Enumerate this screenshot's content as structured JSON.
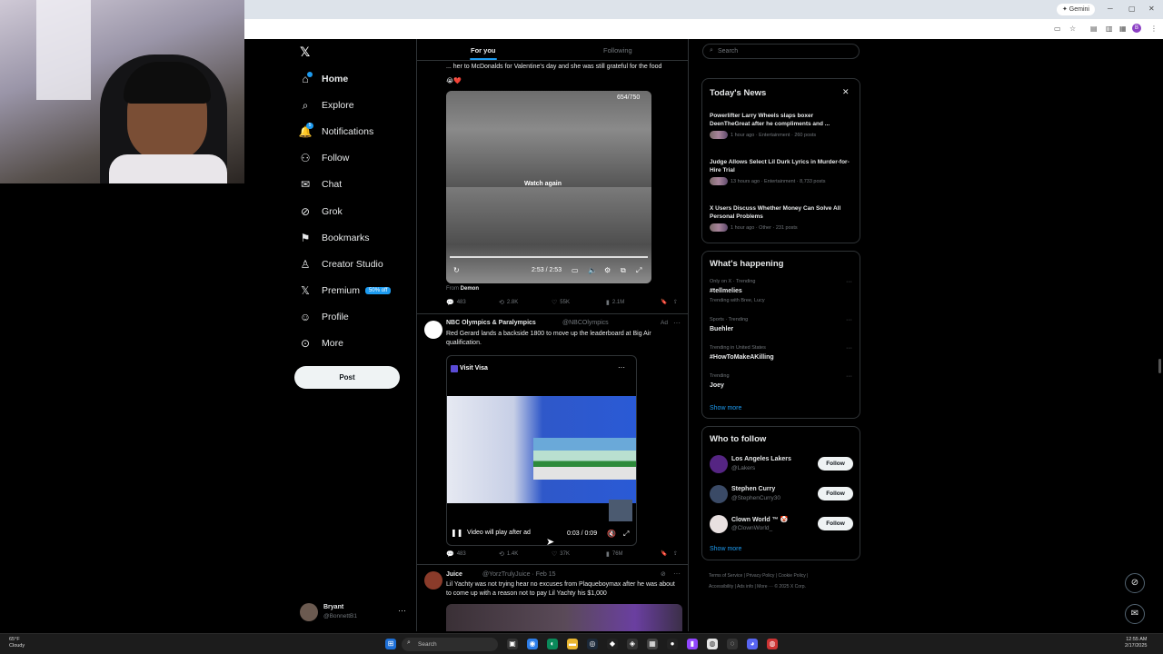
{
  "browser": {
    "gemini_label": "✦ Gemini",
    "profile_initial": "B"
  },
  "nav": {
    "items": [
      {
        "label": "Home",
        "icon": "home-icon"
      },
      {
        "label": "Explore",
        "icon": "search-icon"
      },
      {
        "label": "Notifications",
        "icon": "bell-icon",
        "badge": "5"
      },
      {
        "label": "Follow",
        "icon": "person-plus-icon"
      },
      {
        "label": "Chat",
        "icon": "chat-icon"
      },
      {
        "label": "Grok",
        "icon": "grok-icon"
      },
      {
        "label": "Bookmarks",
        "icon": "bookmark-icon"
      },
      {
        "label": "Creator Studio",
        "icon": "creator-icon"
      },
      {
        "label": "Premium",
        "icon": "x-icon"
      },
      {
        "label": "Profile",
        "icon": "person-icon"
      },
      {
        "label": "More",
        "icon": "more-circle-icon"
      }
    ],
    "premium_badge": "50% off",
    "post_label": "Post",
    "account_name": "Bryant",
    "account_handle": "@BonnettB1",
    "account_more": "···"
  },
  "timeline": {
    "tab_for_you": "For you",
    "tab_following": "Following",
    "tweet1": {
      "text": "... her to McDonalds for Valentine's day and she was still grateful for the food",
      "video_counter": "654/750",
      "watch_again": "Watch again",
      "time": "2:53 / 2:53",
      "from_prefix": "From",
      "from_name": "Demon",
      "replies": "483",
      "reposts": "2.8K",
      "likes": "55K",
      "views": "2.1M"
    },
    "tweet2": {
      "name": "NBC Olympics & Paralympics",
      "handle": "@NBCOlympics",
      "ad_label": "Ad",
      "text": "Red Gerard lands a backside 1800 to move up the leaderboard at Big Air qualification.",
      "visit_label": "Visit Visa",
      "play_label": "Video will play after ad",
      "time": "0:03 / 0:09",
      "replies": "483",
      "reposts": "1.4K",
      "likes": "37K",
      "views": "76M"
    },
    "tweet3": {
      "name": "Juice",
      "handle": "@YorzTrulyJuice · Feb 15",
      "text": "Lil Yachty was not trying hear no excuses from Plaqueboymax after he was about to come up with a reason not to pay Lil Yachty his $1,000"
    }
  },
  "right": {
    "search_placeholder": "Search",
    "news_title": "Today's News",
    "news": [
      {
        "headline": "Powerlifter Larry Wheels slaps boxer DeenTheGreat after he compliments and ...",
        "meta": "1 hour ago · Entertainment · 260 posts"
      },
      {
        "headline": "Judge Allows Select Lil Durk Lyrics in Murder-for-Hire Trial",
        "meta": "13 hours ago · Entertainment · 8,733 posts"
      },
      {
        "headline": "X Users Discuss Whether Money Can Solve All Personal Problems",
        "meta": "1 hour ago · Other · 231 posts"
      }
    ],
    "happening_title": "What's happening",
    "trends": [
      {
        "meta": "Only on X · Trending",
        "name": "#tellmelies",
        "sub": "Trending with Bree, Lucy"
      },
      {
        "meta": "Sports · Trending",
        "name": "Buehler",
        "sub": ""
      },
      {
        "meta": "Trending in United States",
        "name": "#HowToMakeAKilling",
        "sub": ""
      },
      {
        "meta": "Trending",
        "name": "Joey",
        "sub": ""
      }
    ],
    "show_more": "Show more",
    "who_title": "Who to follow",
    "who": [
      {
        "name": "Los Angeles Lakers",
        "handle": "@Lakers",
        "color": "#552583"
      },
      {
        "name": "Stephen Curry",
        "handle": "@StephenCurry30",
        "color": "#3a4a66"
      },
      {
        "name": "Clown World ™ 🤡",
        "handle": "@ClownWorld_",
        "color": "#e8e0e0"
      }
    ],
    "follow_label": "Follow",
    "footer_line1": "Terms of Service  |  Privacy Policy  |  Cookie Policy  |",
    "footer_line2": "Accessibility  |  Ads info  |  More ···  © 2025 X Corp."
  },
  "taskbar": {
    "weather_temp": "65°F",
    "weather_desc": "Cloudy",
    "search_placeholder": "Search",
    "clock_time": "12:55 AM",
    "clock_date": "2/17/2025"
  },
  "colors": {
    "accent": "#1d9bf0",
    "background": "#000000"
  }
}
